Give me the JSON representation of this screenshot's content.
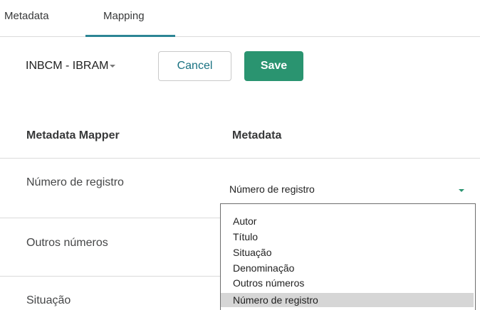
{
  "tabs": [
    {
      "label": "Metadata",
      "active": false
    },
    {
      "label": "Mapping",
      "active": true
    }
  ],
  "toolbar": {
    "mapper_select_label": "INBCM - IBRAM",
    "cancel_label": "Cancel",
    "save_label": "Save"
  },
  "table": {
    "headers": {
      "mapper": "Metadata Mapper",
      "metadata": "Metadata"
    },
    "rows": [
      {
        "label": "Número de registro"
      },
      {
        "label": "Outros números"
      },
      {
        "label": "Situação"
      }
    ]
  },
  "metadata_select": {
    "value": "Número de registro",
    "options": [
      "Autor",
      "Título",
      "Situação",
      "Denominação",
      "Outros números",
      "Número de registro"
    ],
    "selected_option": "Número de registro"
  },
  "colors": {
    "accent": "#2c8595",
    "save_button": "#2a9470",
    "cancel_text": "#187181",
    "selected_option_bg": "#d6d6d6"
  }
}
